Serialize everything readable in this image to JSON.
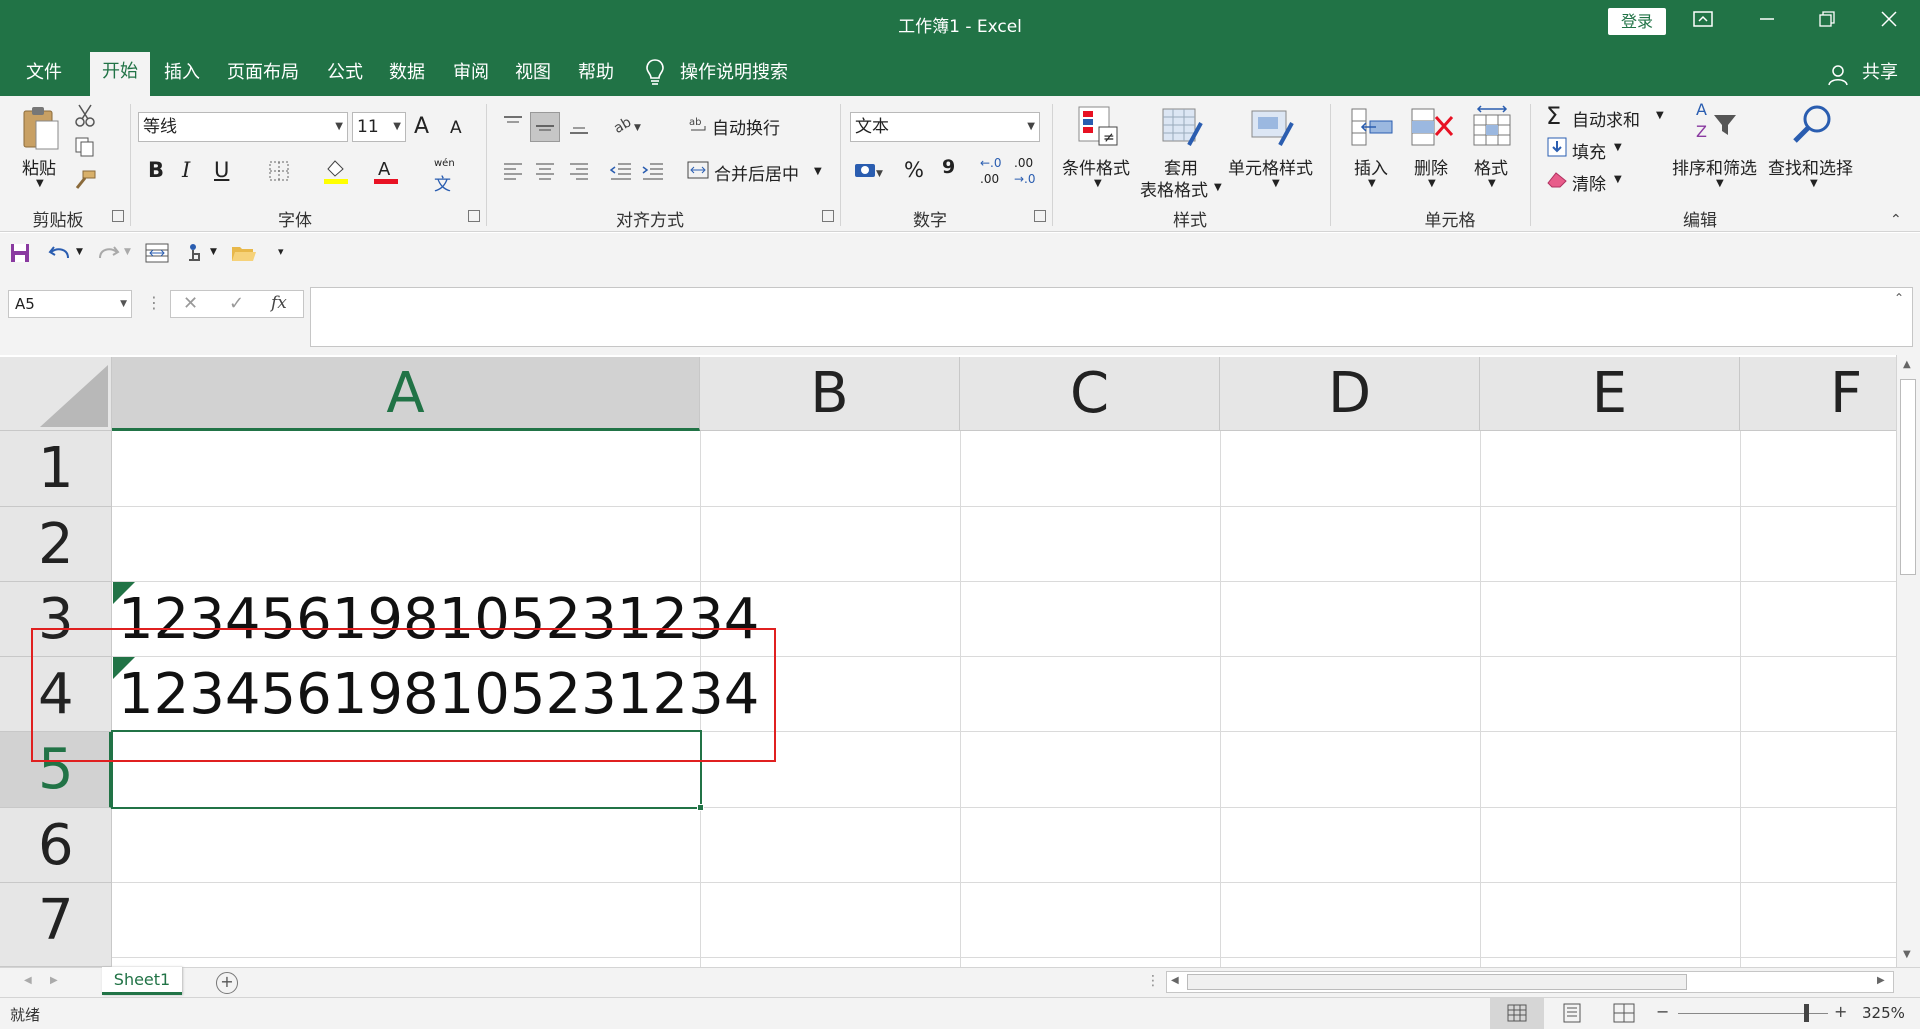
{
  "window": {
    "title": "工作簿1  -  Excel",
    "login_label": "登录",
    "share_label": "共享"
  },
  "tabs": [
    {
      "label": "文件"
    },
    {
      "label": "开始"
    },
    {
      "label": "插入"
    },
    {
      "label": "页面布局"
    },
    {
      "label": "公式"
    },
    {
      "label": "数据"
    },
    {
      "label": "审阅"
    },
    {
      "label": "视图"
    },
    {
      "label": "帮助"
    }
  ],
  "tell_me": "操作说明搜索",
  "ribbon": {
    "clipboard": {
      "paste_label": "粘贴",
      "group_label": "剪贴板"
    },
    "font": {
      "font_name": "等线",
      "font_size": "11",
      "bold": "B",
      "italic": "I",
      "underline": "U",
      "grow": "A",
      "shrink": "A",
      "pinyin_top": "wén",
      "pinyin_bottom": "文",
      "group_label": "字体"
    },
    "alignment": {
      "wrap_label": "自动换行",
      "merge_label": "合并后居中",
      "group_label": "对齐方式"
    },
    "number": {
      "format": "文本",
      "percent": "%",
      "comma": "9",
      "inc_decimal_top": "←.0",
      "inc_decimal_bottom": ".00",
      "dec_decimal_top": ".00",
      "dec_decimal_bottom": "→.0",
      "group_label": "数字"
    },
    "styles": {
      "conditional_label": "条件格式",
      "table_label_1": "套用",
      "table_label_2": "表格格式",
      "cell_styles_label": "单元格样式",
      "group_label": "样式"
    },
    "cells": {
      "insert_label": "插入",
      "delete_label": "删除",
      "format_label": "格式",
      "group_label": "单元格"
    },
    "editing": {
      "autosum_label": "自动求和",
      "fill_label": "填充",
      "clear_label": "清除",
      "sort_label": "排序和筛选",
      "find_label": "查找和选择",
      "group_label": "编辑",
      "sigma": "Σ",
      "sort_a": "A",
      "sort_z": "Z"
    }
  },
  "formula_bar": {
    "name_box": "A5",
    "fx": "fx",
    "formula": ""
  },
  "grid": {
    "columns": [
      "A",
      "B",
      "C",
      "D",
      "E",
      "F"
    ],
    "rows": [
      "1",
      "2",
      "3",
      "4",
      "5",
      "6",
      "7"
    ],
    "cells": {
      "A3": "123456198105231234",
      "A4": "123456198105231234"
    }
  },
  "sheets": [
    {
      "label": "Sheet1"
    }
  ],
  "status": {
    "ready": "就绪",
    "zoom": "325%"
  },
  "colors": {
    "accent": "#217346",
    "highlight_box": "#e02020"
  }
}
